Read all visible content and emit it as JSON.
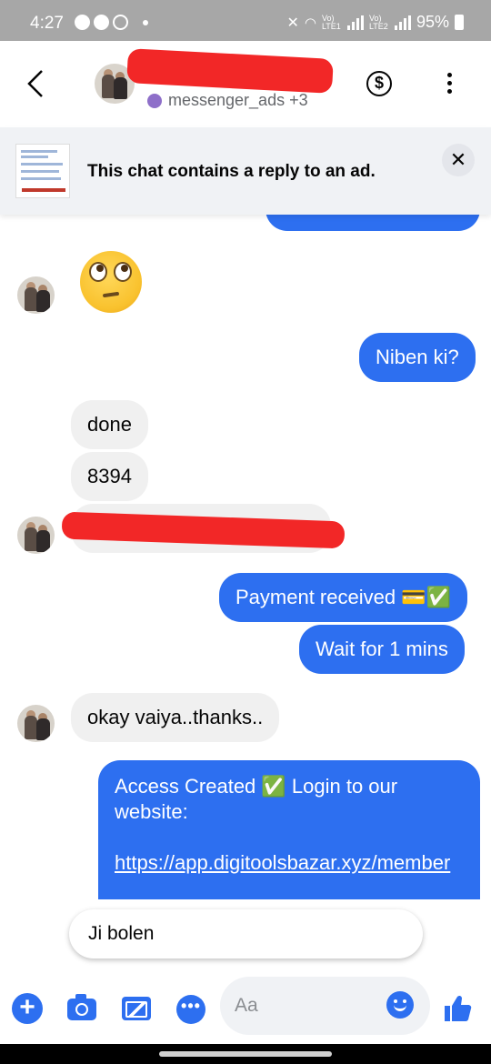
{
  "status_bar": {
    "time": "4:27",
    "battery": "95%",
    "network": [
      "Vo) LTE1",
      "Vo) LTE2"
    ]
  },
  "header": {
    "subtitle": "messenger_ads +3",
    "dollar_symbol": "$"
  },
  "ad_banner": {
    "text": "This chat contains a reply to an ad.",
    "close_symbol": "✕"
  },
  "messages": [
    {
      "direction": "outgoing",
      "text": "Niben ki?"
    },
    {
      "direction": "incoming",
      "text": "done"
    },
    {
      "direction": "incoming",
      "text": "8394"
    },
    {
      "direction": "outgoing",
      "text": "Payment received 💳✅"
    },
    {
      "direction": "outgoing",
      "text": "Wait for 1 mins"
    },
    {
      "direction": "incoming",
      "text": "okay vaiya..thanks.."
    },
    {
      "direction": "outgoing",
      "text_line1": "Access Created ✅ Login to our website:",
      "link": "https://app.digitoolsbazar.xyz/member"
    }
  ],
  "quick_reply": "Ji bolen",
  "composer": {
    "placeholder": "Aa",
    "plus_symbol": "+",
    "more_symbol": "•••"
  },
  "colors": {
    "accent": "#2d6ff0",
    "incoming_bubble": "#f0f0f0",
    "banner_bg": "#f0f2f5"
  }
}
